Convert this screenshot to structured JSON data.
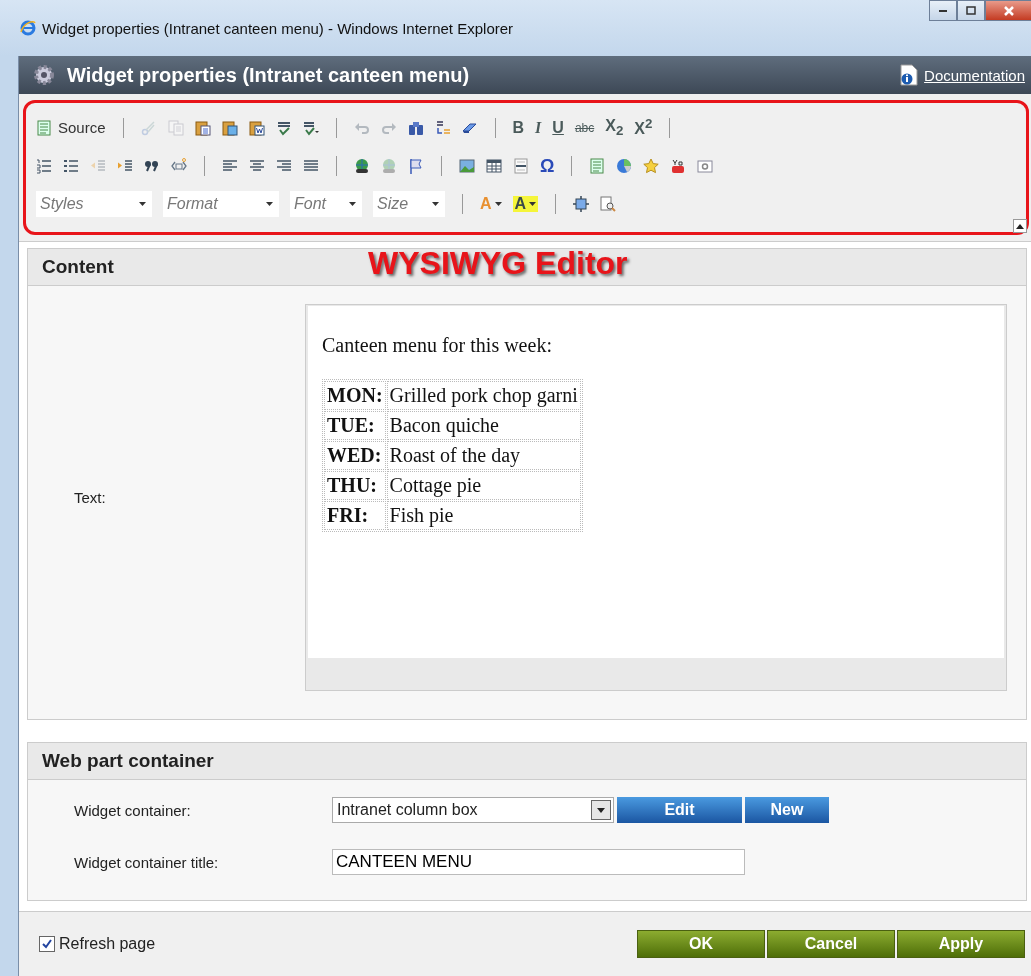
{
  "window": {
    "title": "Widget properties (Intranet canteen menu) - Windows Internet Explorer"
  },
  "header": {
    "title": "Widget properties (Intranet canteen menu)",
    "documentation_link": "Documentation"
  },
  "toolbar": {
    "rows": [
      [
        {
          "kind": "button",
          "label": "Source"
        },
        {
          "kind": "separator"
        },
        {
          "kind": "icon",
          "disabled": true
        },
        {
          "kind": "icon",
          "disabled": true
        },
        {
          "kind": "icon",
          "disabled": false
        },
        {
          "kind": "icon",
          "disabled": false
        },
        {
          "kind": "icon",
          "disabled": false
        },
        {
          "kind": "icon",
          "disabled": false
        },
        {
          "kind": "icon",
          "disabled": false
        },
        {
          "kind": "separator"
        },
        {
          "kind": "icon",
          "disabled": true
        },
        {
          "kind": "icon",
          "disabled": true
        },
        {
          "kind": "icon",
          "disabled": false
        },
        {
          "kind": "icon",
          "disabled": false
        },
        {
          "kind": "icon",
          "disabled": false
        },
        {
          "kind": "separator"
        },
        {
          "kind": "bold",
          "text": "B"
        },
        {
          "kind": "italic",
          "text": "I"
        },
        {
          "kind": "underline",
          "text": "U"
        },
        {
          "kind": "strike",
          "text": "abc"
        },
        {
          "kind": "script",
          "text": "X$_{2}$"
        },
        {
          "kind": "script",
          "text": "X$^{2}$"
        },
        {
          "kind": "separator"
        }
      ],
      [
        {
          "kind": "icon",
          "disabled": false
        },
        {
          "kind": "icon",
          "disabled": false
        },
        {
          "kind": "icon",
          "disabled": true
        },
        {
          "kind": "icon",
          "disabled": false
        },
        {
          "kind": "icon",
          "disabled": false
        },
        {
          "kind": "icon",
          "disabled": false
        },
        {
          "kind": "separator"
        },
        {
          "kind": "icon",
          "disabled": false
        },
        {
          "kind": "icon",
          "disabled": false
        },
        {
          "kind": "icon",
          "disabled": false
        },
        {
          "kind": "icon",
          "disabled": false
        },
        {
          "kind": "separator"
        },
        {
          "kind": "icon",
          "disabled": false
        },
        {
          "kind": "icon",
          "disabled": true
        },
        {
          "kind": "icon",
          "disabled": false
        },
        {
          "kind": "separator"
        },
        {
          "kind": "icon",
          "disabled": false
        },
        {
          "kind": "icon",
          "disabled": false
        },
        {
          "kind": "icon",
          "disabled": false
        },
        {
          "kind": "symbol",
          "text": "Ω"
        },
        {
          "kind": "separator"
        },
        {
          "kind": "icon",
          "disabled": false
        },
        {
          "kind": "icon",
          "disabled": false
        },
        {
          "kind": "icon",
          "disabled": false
        },
        {
          "kind": "icon",
          "disabled": false
        },
        {
          "kind": "icon",
          "disabled": false
        }
      ],
      [
        {
          "kind": "combo",
          "placeholder": "Styles"
        },
        {
          "kind": "combo",
          "placeholder": "Format"
        },
        {
          "kind": "combo",
          "placeholder": "Font"
        },
        {
          "kind": "combo",
          "placeholder": "Size"
        },
        {
          "kind": "separator"
        },
        {
          "kind": "textcolor",
          "text": "A"
        },
        {
          "kind": "highlight",
          "text": "A"
        },
        {
          "kind": "separator"
        },
        {
          "kind": "icon",
          "disabled": false
        },
        {
          "kind": "icon",
          "disabled": false
        }
      ]
    ]
  },
  "annotation": {
    "label": "WYSIWYG Editor"
  },
  "content": {
    "title": "Content",
    "field_label": "Text:",
    "editor": {
      "intro": "Canteen menu for this week:",
      "rows": [
        {
          "day": "MON:",
          "dish": "Grilled pork chop garni"
        },
        {
          "day": "TUE:",
          "dish": "Bacon quiche"
        },
        {
          "day": "WED:",
          "dish": "Roast of the day"
        },
        {
          "day": "THU:",
          "dish": "Cottage pie"
        },
        {
          "day": "FRI:",
          "dish": "Fish pie"
        }
      ]
    }
  },
  "web_part_container": {
    "title": "Web part container",
    "widget_container": {
      "label": "Widget container:",
      "value": "Intranet column box",
      "buttons": [
        "Edit",
        "New"
      ]
    },
    "widget_container_title": {
      "label": "Widget container title:",
      "value": "CANTEEN MENU"
    }
  },
  "footer": {
    "refresh_page": {
      "label": "Refresh page",
      "checked": true
    },
    "buttons": [
      "OK",
      "Cancel",
      "Apply"
    ]
  }
}
